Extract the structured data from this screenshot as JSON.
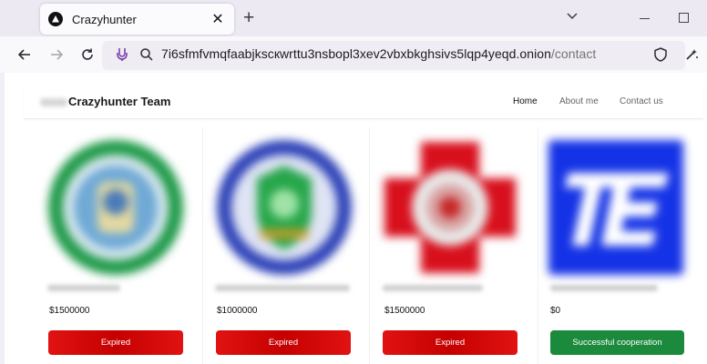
{
  "browser": {
    "tab_title": "Crazyhunter",
    "tab_close_glyph": "✕",
    "new_tab_glyph": "+",
    "url_host": "7i6sfmfvmqfaabjkscкwrttu3nsbopl3xev2vbxbkghsivs5lqp4yeqd.onion",
    "url_path": "/contact",
    "icons": [
      "back-arrow-icon",
      "forward-arrow-icon",
      "reload-icon",
      "tor-onion-icon",
      "search-icon",
      "shield-icon",
      "extensions-icon",
      "tab-list-chevron-icon"
    ]
  },
  "site": {
    "brand": "Crazyhunter Team",
    "nav": [
      {
        "label": "Home"
      },
      {
        "label": "About me"
      },
      {
        "label": "Contact us"
      }
    ]
  },
  "cards": [
    {
      "price": "$1500000",
      "status": "Expired",
      "status_color": "#d40404"
    },
    {
      "price": "$1000000",
      "status": "Expired",
      "status_color": "#d40404"
    },
    {
      "price": "$1500000",
      "status": "Expired",
      "status_color": "#d40404"
    },
    {
      "price": "$0",
      "status": "Successful cooperation",
      "status_color": "#1c8a3c"
    }
  ]
}
